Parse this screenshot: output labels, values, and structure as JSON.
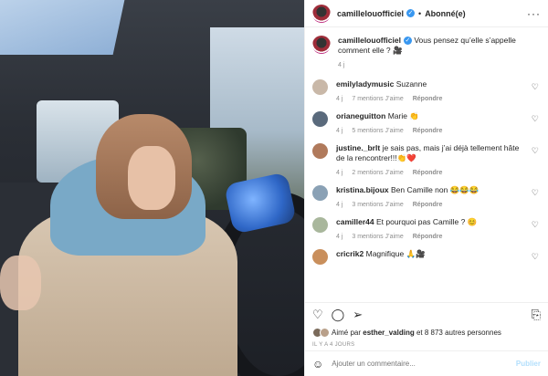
{
  "post": {
    "username": "camillelouofficiel",
    "follow_label": "Abonné(e)",
    "more_label": "···"
  },
  "caption": {
    "username": "camillelouofficiel",
    "text": "Vous pensez qu’elle s’appelle comment elle ? 🎥",
    "time": "4 j"
  },
  "comments": [
    {
      "username": "emilyladymusic",
      "text": "Suzanne",
      "time": "4 j",
      "likes": "7 mentions J’aime",
      "reply": "Répondre",
      "avatar_color": "#c9b8a8"
    },
    {
      "username": "orianeguitton",
      "text": "Marie 👏",
      "time": "4 j",
      "likes": "5 mentions J’aime",
      "reply": "Répondre",
      "avatar_color": "#5a6a7c"
    },
    {
      "username": "justine._brlt",
      "text": "je sais pas, mais j’ai déjà tellement hâte de la rencontrer!!!👏❤️",
      "time": "4 j",
      "likes": "2 mentions J’aime",
      "reply": "Répondre",
      "avatar_color": "#b07a5c"
    },
    {
      "username": "kristina.bijoux",
      "text": "Ben Camille non 😂😂😂",
      "time": "4 j",
      "likes": "3 mentions J’aime",
      "reply": "Répondre",
      "avatar_color": "#8aa1b5"
    },
    {
      "username": "camiller44",
      "text": "Et pourquoi pas Camille ? 😊",
      "time": "4 j",
      "likes": "3 mentions J’aime",
      "reply": "Répondre",
      "avatar_color": "#a9b79c"
    },
    {
      "username": "cricrik2",
      "text": "Magnifique 🙏🎥",
      "time": "",
      "likes": "",
      "reply": "",
      "avatar_color": "#c98f5c"
    }
  ],
  "icons": {
    "heart": "♡",
    "comment": "◯",
    "share": "➢",
    "bookmark": "⎘",
    "emoji": "☺"
  },
  "likes": {
    "prefix": "Aimé par",
    "user": "esther_valding",
    "suffix": "et 8 873 autres personnes"
  },
  "timestamp": "IL Y A 4 JOURS",
  "add_comment": {
    "placeholder": "Ajouter un commentaire...",
    "publish_label": "Publier"
  },
  "colors": {
    "verified": "#3897f0",
    "publish_disabled": "#b2dffc",
    "meta_gray": "#8e8e8e"
  }
}
